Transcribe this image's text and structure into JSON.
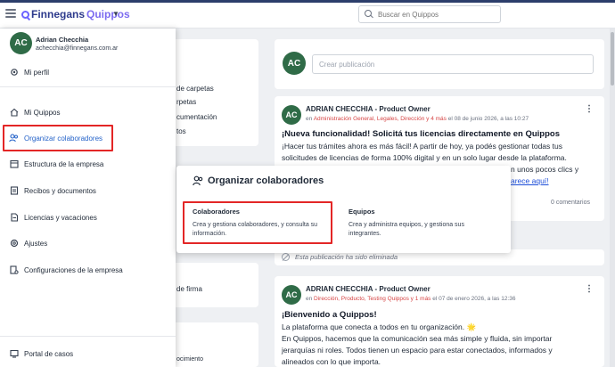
{
  "header": {
    "logo_main": "Finnegans",
    "logo_suffix": "Quippos",
    "search_placeholder": "Buscar en Quippos"
  },
  "user": {
    "initials": "AC",
    "name": "Adrian Checchia",
    "email": "achecchia@finnegans.com.ar"
  },
  "sidebar": {
    "profile": "Mi perfil",
    "items": [
      {
        "label": "Mi Quippos",
        "icon": "home-icon"
      },
      {
        "label": "Organizar colaboradores",
        "icon": "people-icon",
        "active": true
      },
      {
        "label": "Estructura de la empresa",
        "icon": "building-icon"
      },
      {
        "label": "Recibos y documentos",
        "icon": "document-icon"
      },
      {
        "label": "Licencias y vacaciones",
        "icon": "calendar-file-icon"
      },
      {
        "label": "Ajustes",
        "icon": "gear-icon"
      },
      {
        "label": "Configuraciones de la empresa",
        "icon": "company-settings-icon"
      }
    ],
    "footer": "Portal de casos"
  },
  "background_left": {
    "items": [
      "de carpetas",
      "rpetas",
      "cumentación",
      "tos",
      "de firma",
      "ocimiento"
    ]
  },
  "popup": {
    "title": "Organizar colaboradores",
    "options": [
      {
        "title": "Colaboradores",
        "desc": "Crea y gestiona colaboradores, y consulta su información."
      },
      {
        "title": "Equipos",
        "desc": "Crea y administra equipos, y gestiona sus integrantes."
      }
    ]
  },
  "feed": {
    "compose_placeholder": "Crear publicación",
    "post1": {
      "initials": "AC",
      "author": "ADRIAN CHECCHIA - Product Owner",
      "meta_prefix": "en ",
      "meta_targets": "Administración General, Legales, Dirección y 4 más",
      "meta_suffix": " el 08 de junio 2026, a las 10:27",
      "title": "¡Nueva funcionalidad! Solicitá tus licencias directamente en Quippos",
      "body1": "¡Hacer tus trámites ahora es más fácil! A partir de hoy, ya podés gestionar todas tus",
      "body2": "solicitudes de licencias de forma 100% digital y en un solo lugar desde la plataforma.",
      "body3": "n unos pocos clics y",
      "body4": "arece aquí!",
      "comments": "0 comentarios"
    },
    "deleted": "Esta publicación ha sido eliminada",
    "post2": {
      "initials": "AC",
      "author": "ADRIAN CHECCHIA - Product Owner",
      "meta_prefix": "en ",
      "meta_targets": "Dirección, Producto, Testing Quippos y 1 más",
      "meta_suffix": " el 07 de enero 2026, a las 12:36",
      "title": "¡Bienvenido a Quippos!",
      "body1": "La plataforma que conecta a todos en tu organización. 🌟",
      "body2": "En Quippos, hacemos que la comunicación sea más simple y fluida, sin importar",
      "body3": "jerarquías ni roles. Todos tienen un espacio para estar conectados, informados y",
      "body4": "alineados con lo que importa."
    }
  }
}
